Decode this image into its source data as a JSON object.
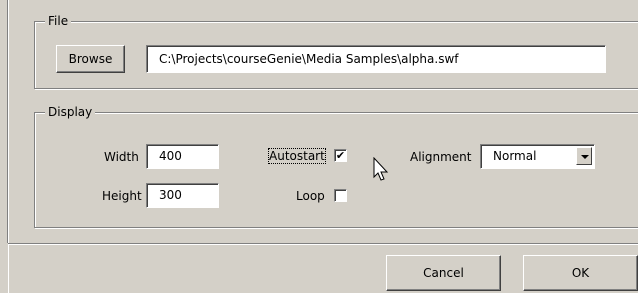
{
  "file": {
    "legend": "File",
    "browse_label": "Browse",
    "path": "C:\\Projects\\courseGenie\\Media Samples\\alpha.swf"
  },
  "display": {
    "legend": "Display",
    "width_label": "Width",
    "width_value": "400",
    "height_label": "Height",
    "height_value": "300",
    "autostart_label": "Autostart",
    "autostart_checked": "✔",
    "loop_label": "Loop",
    "alignment_label": "Alignment",
    "alignment_value": "Normal"
  },
  "buttons": {
    "cancel_label": "Cancel",
    "ok_label": "OK"
  },
  "icons": [
    "pointer-cursor-icon",
    "dropdown-arrow-icon",
    "checkmark-icon"
  ]
}
